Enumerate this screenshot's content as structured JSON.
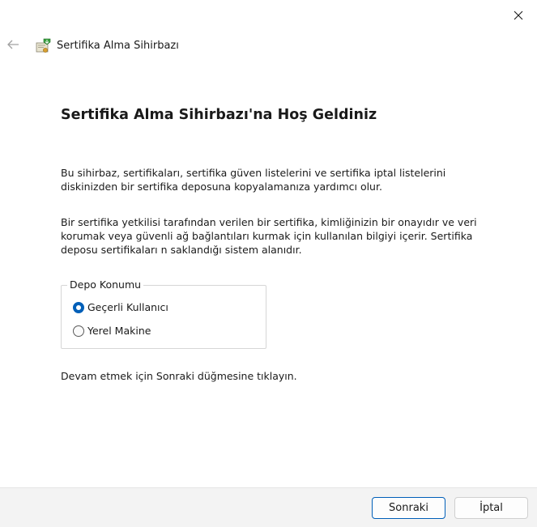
{
  "window": {
    "close_icon": "close-icon"
  },
  "navbar": {
    "back_icon": "back-arrow-icon",
    "wizard_icon": "certificate-wizard-icon",
    "title": "Sertifika Alma Sihirbazı"
  },
  "main": {
    "heading": "Sertifika Alma Sihirbazı'na Hoş Geldiniz",
    "paragraph1": "Bu sihirbaz, sertifikaları, sertifika güven listelerini ve sertifika iptal listelerini diskinizden bir sertifika deposuna kopyalamanıza yardımcı olur.",
    "paragraph2": "Bir sertifika yetkilisi tarafından verilen bir sertifika, kimliğinizin bir onayıdır ve veri korumak veya güvenli ağ bağlantıları kurmak için kullanılan bilgiyi içerir. Sertifika deposu sertifikaları n saklandığı sistem alanıdır.",
    "store_location": {
      "legend": "Depo Konumu",
      "options": [
        {
          "label": "Geçerli Kullanıcı",
          "selected": true
        },
        {
          "label": "Yerel Makine",
          "selected": false
        }
      ]
    },
    "instruction": "Devam etmek için Sonraki düğmesine tıklayın."
  },
  "footer": {
    "next_label": "Sonraki",
    "cancel_label": "İptal"
  },
  "colors": {
    "accent": "#005fb8",
    "footer_bg": "#f3f3f3"
  }
}
